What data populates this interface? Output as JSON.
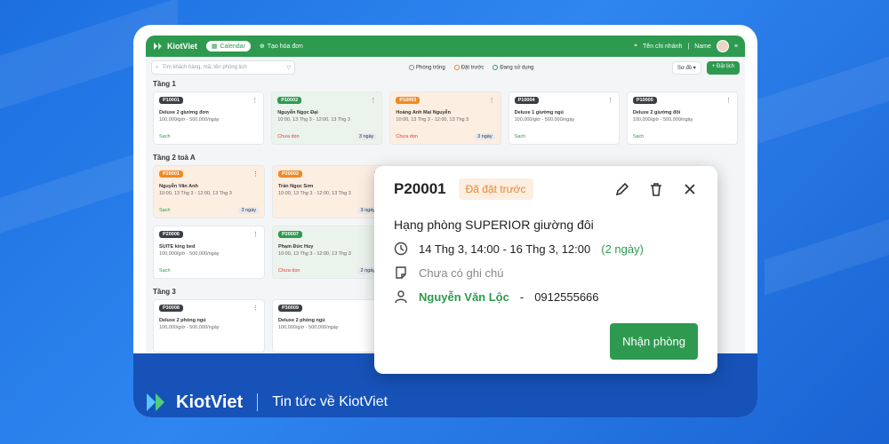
{
  "app": {
    "brand": "KiotViet",
    "nav": {
      "calendar": "Calendar",
      "create_invoice": "Tạo hóa đơn",
      "branch": "Tên chi nhánh",
      "user": "Name"
    },
    "toolbar": {
      "search_placeholder": "Tìm khách hàng, mã, tên phòng lịch",
      "legend": [
        "Phòng trống",
        "Đặt trước",
        "Đang sử dụng"
      ],
      "view_select": "Sơ đồ",
      "add_button": "+ Đặt lịch"
    }
  },
  "floors": [
    {
      "name": "Tầng 1",
      "rooms": [
        {
          "code": "P10001",
          "name": "Deluxe 2 giường đơn",
          "info": "100,000/giờ  -  500,000/ngày",
          "status": "Sạch",
          "days": "",
          "variant": "white"
        },
        {
          "code": "P10002",
          "name": "Nguyễn Ngọc Đại",
          "info": "10:00, 13 Thg 3 - 12:00, 13 Thg 3",
          "status": "Chưa dọn",
          "days": "3 ngày",
          "variant": "green"
        },
        {
          "code": "P10003",
          "name": "Hoàng Anh Mai Nguyễn",
          "info": "10:00, 13 Thg 3 - 12:00, 13 Thg 3",
          "status": "Chưa dọn",
          "days": "3 ngày",
          "variant": "orange"
        },
        {
          "code": "P10004",
          "name": "Deluxe 1 giường ngủ",
          "info": "100,000/giờ  -  500,000/ngày",
          "status": "Sạch",
          "days": "",
          "variant": "white"
        },
        {
          "code": "P10005",
          "name": "Deluxe 2 giường đôi",
          "info": "100,000/giờ  -  500,000/ngày",
          "status": "Sạch",
          "days": "",
          "variant": "white"
        }
      ]
    },
    {
      "name": "Tầng 2 toà A",
      "rooms": [
        {
          "code": "P20001",
          "name": "Nguyễn Văn Anh",
          "info": "10:00, 13 Thg 3 - 12:00, 13 Thg 3",
          "status": "Sạch",
          "days": "3 ngày",
          "variant": "orange"
        },
        {
          "code": "P20002",
          "name": "Trần Ngọc Sơn",
          "info": "10:00, 13 Thg 3 - 12:00, 13 Thg 3",
          "status": "",
          "days": "3 ngày",
          "variant": "orange"
        }
      ],
      "rooms2": [
        {
          "code": "P20006",
          "name": "SUITE king bed",
          "info": "100,000/giờ  -  500,000/ngày",
          "status": "Sạch",
          "days": "",
          "variant": "white"
        },
        {
          "code": "P20007",
          "name": "Phạm Đức Huy",
          "info": "10:00, 13 Thg 3 - 12:00, 13 Thg 3",
          "status": "Chưa dọn",
          "days": "2 ngày",
          "variant": "green"
        }
      ]
    },
    {
      "name": "Tầng 3",
      "rooms": [
        {
          "code": "P30008",
          "name": "Deluxe 2 phòng ngủ",
          "info": "100,000/giờ  -  500,000/ngày",
          "status": "",
          "days": "",
          "variant": "white"
        },
        {
          "code": "P30009",
          "name": "Deluxe 2 phòng ngủ",
          "info": "100,000/giờ  -  500,000/ngày",
          "status": "",
          "days": "",
          "variant": "white"
        }
      ]
    }
  ],
  "popup": {
    "code": "P20001",
    "badge": "Đã đặt trước",
    "room_type": "Hạng phòng SUPERIOR giường đôi",
    "time_range": "14 Thg 3, 14:00 - 16 Thg 3, 12:00",
    "duration": "(2 ngày)",
    "note": "Chưa có ghi chú",
    "customer_name": "Nguyễn Văn Lộc",
    "dash": "-",
    "customer_phone": "0912555666",
    "checkin_button": "Nhận phòng"
  },
  "footer": {
    "brand": "KiotViet",
    "tagline": "Tin tức về KiotViet"
  },
  "colors": {
    "brand_green": "#2e9a4f",
    "background_blue": "#2f86f0",
    "reserved_orange": "#e8862a"
  }
}
